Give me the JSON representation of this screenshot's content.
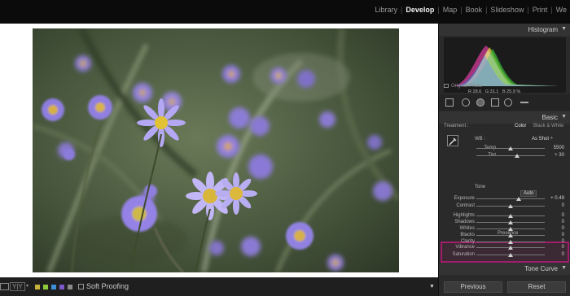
{
  "modules": [
    "Library",
    "Develop",
    "Map",
    "Book",
    "Slideshow",
    "Print",
    "We"
  ],
  "active_module": "Develop",
  "toolbar": {
    "label_yy": "Y|Y",
    "soft_proofing": "Soft Proofing"
  },
  "flag_colors": [
    "#c8b33a",
    "#8fc93a",
    "#3e8fd8",
    "#7a58c8",
    "#8a8a8a"
  ],
  "panel": {
    "histogram": {
      "title": "Histogram",
      "r_label": "R",
      "r": "28.6",
      "g_label": "G",
      "g": "31.1",
      "b_label": "B",
      "b": "25.9",
      "unit": "%",
      "original_photo": "Original Photo"
    },
    "basic": {
      "title": "Basic",
      "treatment_label": "Treatment :",
      "treatment_color": "Color",
      "treatment_bw": "Black & White",
      "wb_label": "WB :",
      "wb_value": "As Shot ÷",
      "tone_label": "Tone",
      "auto_label": "Auto",
      "presence_label": "Presence",
      "sliders": {
        "temp": {
          "label": "Temp",
          "value": "5500",
          "pos": 0.5
        },
        "tint": {
          "label": "Tint",
          "value": "+ 30",
          "pos": 0.6
        },
        "exposure": {
          "label": "Exposure",
          "value": "+ 0.49",
          "pos": 0.62
        },
        "contrast": {
          "label": "Contrast",
          "value": "0",
          "pos": 0.5
        },
        "highlights": {
          "label": "Highlights",
          "value": "0",
          "pos": 0.5
        },
        "shadows": {
          "label": "Shadows",
          "value": "0",
          "pos": 0.5
        },
        "whites": {
          "label": "Whites",
          "value": "0",
          "pos": 0.5
        },
        "blacks": {
          "label": "Blacks",
          "value": "0",
          "pos": 0.5
        },
        "clarity": {
          "label": "Clarity",
          "value": "0",
          "pos": 0.5
        },
        "vibrance": {
          "label": "Vibrance",
          "value": "0",
          "pos": 0.5
        },
        "saturation": {
          "label": "Saturation",
          "value": "0",
          "pos": 0.5
        }
      }
    },
    "tone_curve": {
      "title": "Tone Curve"
    },
    "buttons": {
      "previous": "Previous",
      "reset": "Reset"
    }
  }
}
